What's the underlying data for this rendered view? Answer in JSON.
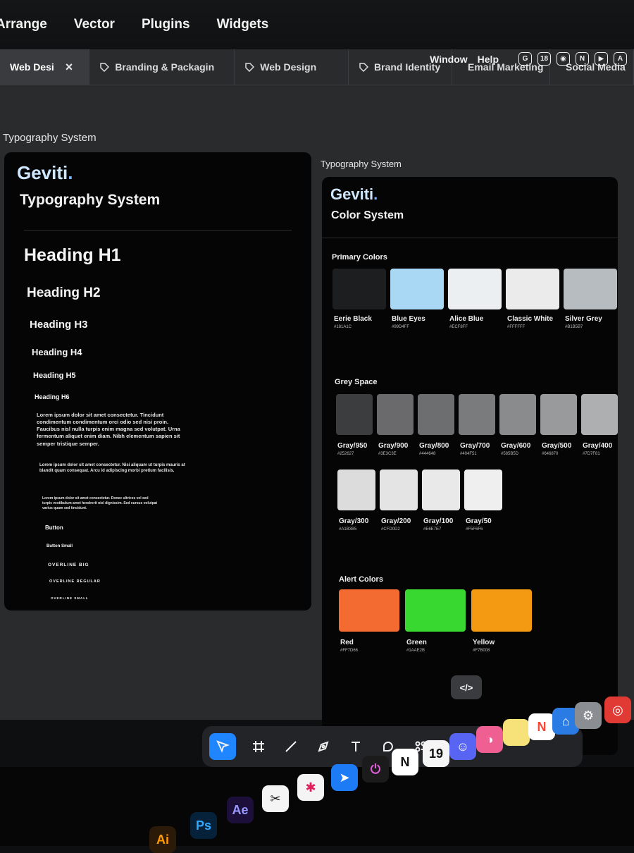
{
  "menubar": {
    "items": [
      "Arrange",
      "Vector",
      "Plugins",
      "Widgets"
    ]
  },
  "tabs": [
    {
      "label": "Web Desi",
      "active": true,
      "close": "×"
    },
    {
      "label": "Branding & Packagin"
    },
    {
      "label": "Web Design"
    },
    {
      "label": "Brand Identity"
    },
    {
      "label": "Email Marketing"
    },
    {
      "label": "Social Media"
    }
  ],
  "system_menu": {
    "window": "Window",
    "help": "Help",
    "tray": [
      "G",
      "18",
      "◉",
      "N",
      "▶",
      "A"
    ]
  },
  "canvas": {
    "left_frame_label": "Typography System",
    "right_frame_label": "Typography System"
  },
  "left_frame": {
    "logo": "Geviti",
    "title": "Typography System",
    "headings": [
      "Heading H1",
      "Heading H2",
      "Heading H3",
      "Heading H4",
      "Heading H5",
      "Heading H6"
    ],
    "body_large": "Lorem ipsum dolor sit amet consectetur. Tincidunt condimentum condimentum orci odio sed nisi proin. Faucibus nisl nulla turpis enim magna sed volutpat. Urna fermentum aliquet enim diam. Nibh elementum sapien sit semper tristique semper.",
    "body_medium": "Lorem ipsum dolor sit amet consectetur. Nisi aliquam ut turpis mauris at blandit quam consequat. Arcu id adipiscing morbi pretium facilisis.",
    "body_small": "Lorem ipsum dolor sit amet consectetur. Donec ultrices vel sed turpis vestibulum amet hendrerit nisl dignissim. Sed cursus volutpat varius quam sed tincidunt.",
    "button": "Button",
    "button_small": "Button Small",
    "overline_big": "OVERLINE BIG",
    "overline_regular": "OVERLINE REGULAR",
    "overline_small": "OVERLINE SMALL"
  },
  "right_frame": {
    "logo": "Geviti",
    "title": "Color System",
    "primary_label": "Primary Colors",
    "primary": [
      {
        "name": "Eerie Black",
        "hex": "#181A1C",
        "color": "#1c1e20"
      },
      {
        "name": "Blue Eyes",
        "hex": "#99D4FF",
        "color": "#a9d8f4"
      },
      {
        "name": "Alice Blue",
        "hex": "#ECF8FF",
        "color": "#eceff2"
      },
      {
        "name": "Classic White",
        "hex": "#FFFFFF",
        "color": "#ebebeb"
      },
      {
        "name": "Silver Grey",
        "hex": "#B1B5B7",
        "color": "#b7bcc0"
      }
    ],
    "grey_label": "Grey Space",
    "greys_row1": [
      {
        "name": "Gray/950",
        "hex": "#252627",
        "color": "#3c3d3f"
      },
      {
        "name": "Gray/900",
        "hex": "#3E3C3E",
        "color": "#6a696b"
      },
      {
        "name": "Gray/800",
        "hex": "#444648",
        "color": "#6d6e70"
      },
      {
        "name": "Gray/700",
        "hex": "#404F51",
        "color": "#7a7b7d"
      },
      {
        "name": "Gray/600",
        "hex": "#585B5D",
        "color": "#8a8b8d"
      },
      {
        "name": "Gray/500",
        "hex": "#646870",
        "color": "#999a9c"
      },
      {
        "name": "Gray/400",
        "hex": "#7D7F81",
        "color": "#aeafb1"
      }
    ],
    "greys_row2": [
      {
        "name": "Gray/300",
        "hex": "#A1B3B5",
        "color": "#dcdcdc"
      },
      {
        "name": "Gray/200",
        "hex": "#CFD0D2",
        "color": "#e4e4e4"
      },
      {
        "name": "Gray/100",
        "hex": "#E6E7E7",
        "color": "#e9e9e9"
      },
      {
        "name": "Gray/50",
        "hex": "#F5F6F6",
        "color": "#efefef"
      }
    ],
    "alert_label": "Alert Colors",
    "alerts": [
      {
        "name": "Red",
        "hex": "#FF7D66",
        "color": "#f36b30"
      },
      {
        "name": "Green",
        "hex": "#1AAE2B",
        "color": "#39d831"
      },
      {
        "name": "Yellow",
        "hex": "#F7B008",
        "color": "#f39a12"
      }
    ]
  },
  "toolbar": {
    "code_label": "</>"
  },
  "dock": {
    "apps": [
      "Ai",
      "Ps",
      "Ae",
      "CapCut",
      "Slack",
      "Spark",
      "Clockify",
      "Notion",
      "Calendar",
      "Discord",
      "Dropzone",
      "Notes",
      "News",
      "Keynote",
      "System Settings",
      "Creative Cloud"
    ],
    "calendar_day": "19",
    "notion_letter": "N"
  }
}
